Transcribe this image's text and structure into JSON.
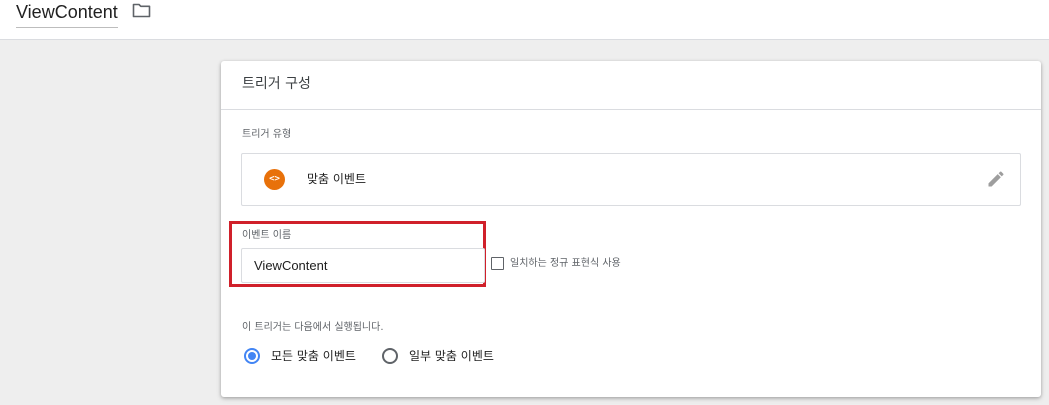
{
  "header": {
    "trigger_name": "ViewContent",
    "folder_icon": "folder-icon"
  },
  "card": {
    "title": "트리거 구성",
    "trigger_type_label": "트리거 유형",
    "trigger_type": {
      "icon_glyph": "<>",
      "icon": "custom-event-icon",
      "icon_color": "#e8710a",
      "name": "맞춤 이벤트",
      "edit_icon": "pencil-icon"
    },
    "event_name": {
      "label": "이벤트 이름",
      "value": "ViewContent",
      "highlight_color": "#d0202a"
    },
    "regex": {
      "checked": false,
      "label": "일치하는 정규 표현식 사용"
    },
    "fires_on": {
      "label": "이 트리거는 다음에서 실행됩니다.",
      "options": [
        {
          "label": "모든 맞춤 이벤트",
          "selected": true
        },
        {
          "label": "일부 맞춤 이벤트",
          "selected": false
        }
      ],
      "accent_color": "#4285f4"
    }
  }
}
